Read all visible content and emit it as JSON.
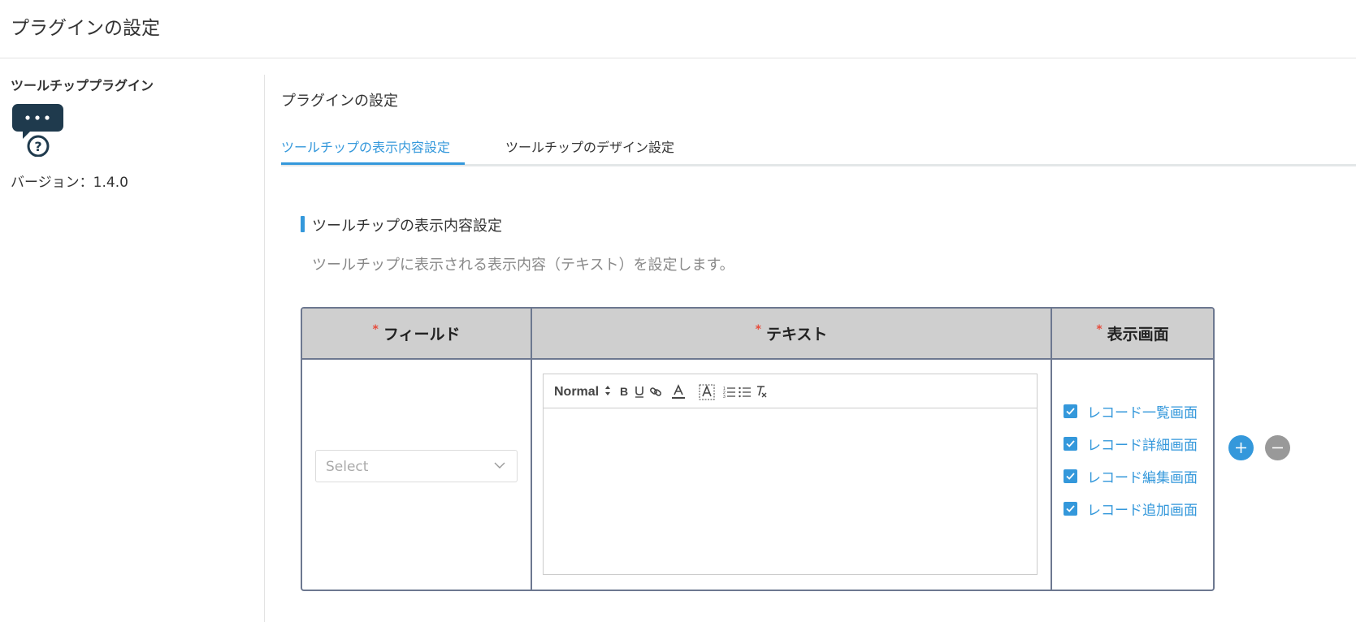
{
  "header": {
    "title": "プラグインの設定"
  },
  "sidebar": {
    "plugin_name": "ツールチッププラグイン",
    "version": "バージョン：1.4.0"
  },
  "main": {
    "title": "プラグインの設定",
    "tabs": [
      {
        "label": "ツールチップの表示内容設定",
        "active": true
      },
      {
        "label": "ツールチップのデザイン設定",
        "active": false
      }
    ],
    "section": {
      "title": "ツールチップの表示内容設定",
      "description": "ツールチップに表示される表示内容（テキスト）を設定します。"
    },
    "table": {
      "required_mark": "*",
      "headers": [
        "フィールド",
        "テキスト",
        "表示画面"
      ],
      "row": {
        "field_select": {
          "placeholder": "Select",
          "value": ""
        },
        "editor": {
          "format_label": "Normal",
          "toolbar_icons": [
            "bold-icon",
            "underline-icon",
            "link-icon",
            "font-color-icon",
            "background-color-icon",
            "ordered-list-icon",
            "bullet-list-icon",
            "clear-format-icon"
          ],
          "content": ""
        },
        "screens": [
          {
            "label": "レコード一覧画面",
            "checked": true
          },
          {
            "label": "レコード詳細画面",
            "checked": true
          },
          {
            "label": "レコード編集画面",
            "checked": true
          },
          {
            "label": "レコード追加画面",
            "checked": true
          }
        ]
      }
    }
  },
  "colors": {
    "accent": "#3498db",
    "required": "#e74c3c",
    "table_header_bg": "#cfcfcf",
    "table_border": "#6d7890",
    "icon_dark": "#1f3a4d",
    "remove_button": "#999999"
  }
}
